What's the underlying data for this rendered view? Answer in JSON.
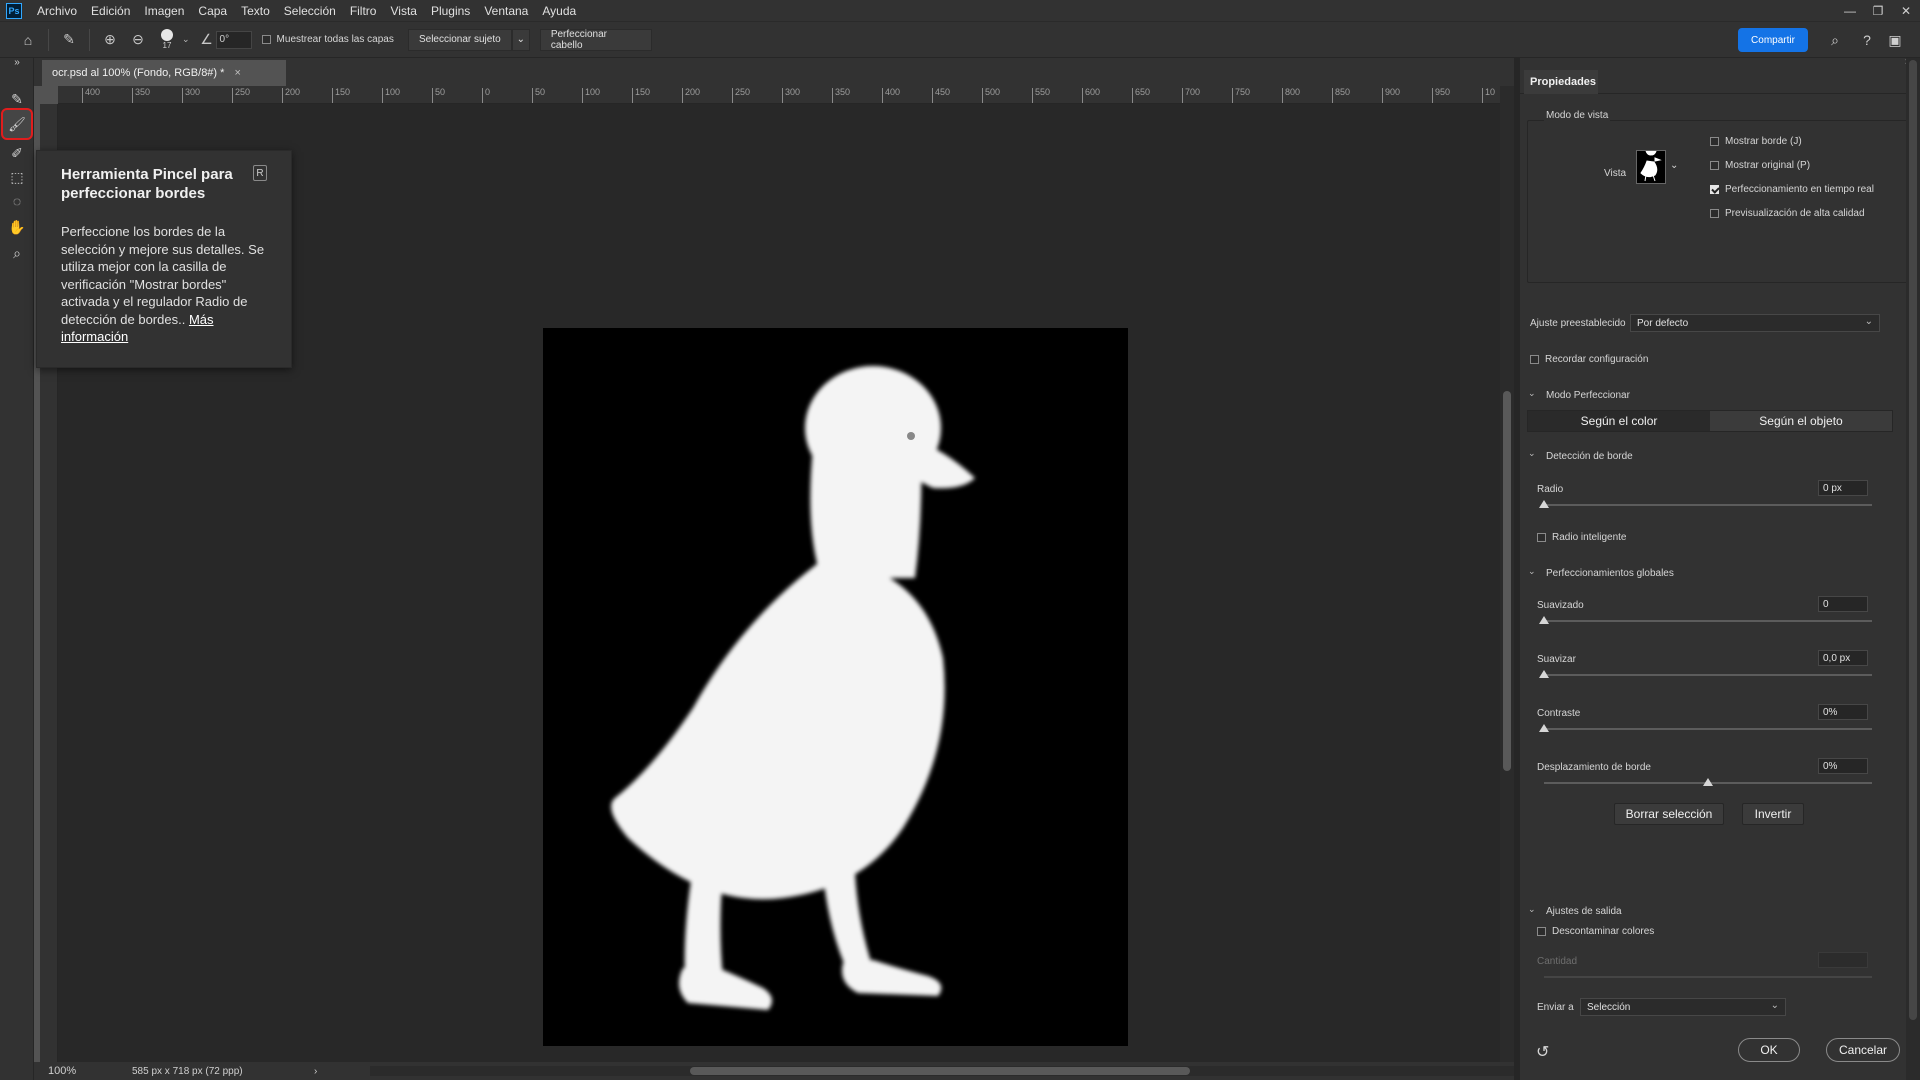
{
  "app": {
    "logo": "Ps"
  },
  "menu": [
    "Archivo",
    "Edición",
    "Imagen",
    "Capa",
    "Texto",
    "Selección",
    "Filtro",
    "Vista",
    "Plugins",
    "Ventana",
    "Ayuda"
  ],
  "window_controls": [
    "—",
    "❐",
    "✕"
  ],
  "optionsbar": {
    "brush_size": "17",
    "angle": "0°",
    "sample_all_layers": "Muestrear todas las capas",
    "select_subject": "Seleccionar sujeto",
    "refine_hair": "Perfeccionar cabello",
    "share": "Compartir"
  },
  "document": {
    "tab_title": "ocr.psd al 100% (Fondo, RGB/8#) *",
    "zoom": "100%",
    "dimensions": "585 px x 718 px (72 ppp)"
  },
  "ruler": {
    "h_ticks": [
      "400",
      "350",
      "300",
      "250",
      "200",
      "150",
      "100",
      "50",
      "0",
      "50",
      "100",
      "150",
      "200",
      "250",
      "300",
      "350",
      "400",
      "450",
      "500",
      "550",
      "600",
      "650",
      "700",
      "750",
      "800",
      "850",
      "900",
      "950",
      "10"
    ]
  },
  "tooltip": {
    "title": "Herramienta Pincel para perfeccionar bordes",
    "shortcut": "R",
    "body": "Perfeccione los bordes de la selección y mejore sus detalles. Se utiliza mejor con la casilla de verificación \"Mostrar bordes\" activada y el regulador Radio de detección de bordes..",
    "link": "Más información"
  },
  "properties": {
    "tab": "Propiedades",
    "view_mode": "Modo de vista",
    "view_label": "Vista",
    "show_edge": "Mostrar borde (J)",
    "show_original": "Mostrar original (P)",
    "realtime": "Perfeccionamiento en tiempo real",
    "high_quality": "Previsualización de alta calidad",
    "preset_label": "Ajuste preestablecido",
    "preset_value": "Por defecto",
    "remember": "Recordar configuración",
    "refine_mode": "Modo Perfeccionar",
    "by_color": "Según el color",
    "by_object": "Según el objeto",
    "edge_detection": "Detección de borde",
    "radius_label": "Radio",
    "radius_value": "0 px",
    "smart_radius": "Radio inteligente",
    "global_refinements": "Perfeccionamientos globales",
    "smooth_label": "Suavizado",
    "smooth_value": "0",
    "feather_label": "Suavizar",
    "feather_value": "0,0 px",
    "contrast_label": "Contraste",
    "contrast_value": "0%",
    "shift_label": "Desplazamiento de borde",
    "shift_value": "0%",
    "clear_selection": "Borrar selección",
    "invert": "Invertir",
    "output_settings": "Ajustes de salida",
    "decontaminate": "Descontaminar colores",
    "amount_label": "Cantidad",
    "send_to_label": "Enviar a",
    "send_to_value": "Selección",
    "ok": "OK",
    "cancel": "Cancelar"
  },
  "colors": {
    "accent": "#1473e6",
    "highlight": "#e01d1d"
  }
}
